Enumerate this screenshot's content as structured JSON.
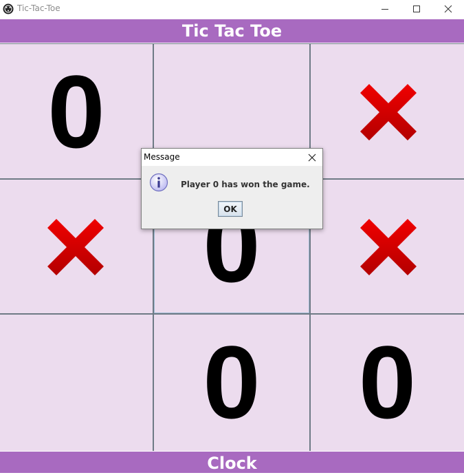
{
  "window": {
    "title": "Tic-Tac-Toe",
    "icon": "app-icon",
    "controls": {
      "minimize": "minimize-icon",
      "maximize": "maximize-icon",
      "close": "close-icon"
    }
  },
  "header": {
    "title": "Tic Tac Toe",
    "background": "#a86ac0"
  },
  "board": {
    "cell_background": "#ecdcee",
    "grid_color": "#6e7a85",
    "cells": [
      {
        "mark": "0"
      },
      {
        "mark": ""
      },
      {
        "mark": "X"
      },
      {
        "mark": "X"
      },
      {
        "mark": "0"
      },
      {
        "mark": "X"
      },
      {
        "mark": ""
      },
      {
        "mark": "0"
      },
      {
        "mark": "0"
      }
    ],
    "x_color": "#dd0000",
    "o_color": "#000000"
  },
  "footer": {
    "label": "Clock"
  },
  "dialog": {
    "title": "Message",
    "icon": "info-icon",
    "message": "Player 0 has won the game.",
    "ok_label": "OK"
  }
}
